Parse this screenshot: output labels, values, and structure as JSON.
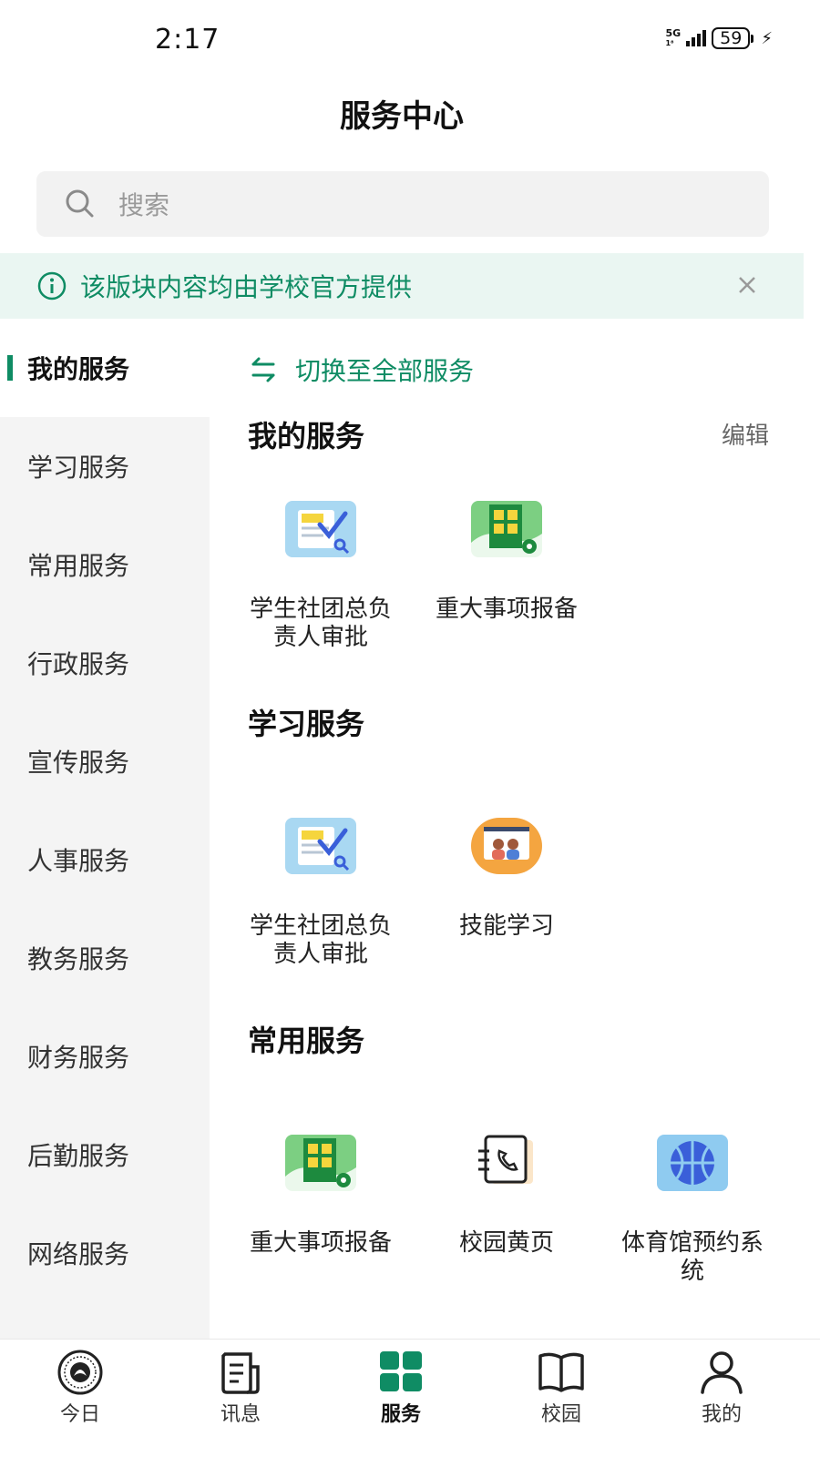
{
  "status_bar": {
    "time": "2:17",
    "network": "5G",
    "network_sub": "1⁸",
    "battery": "59"
  },
  "header": {
    "title": "服务中心"
  },
  "search": {
    "placeholder": "搜索",
    "icon": "search-icon"
  },
  "notice": {
    "text": "该版块内容均由学校官方提供",
    "icon": "info-icon",
    "close_icon": "close-icon"
  },
  "sidebar": {
    "items": [
      {
        "label": "我的服务",
        "active": true
      },
      {
        "label": "学习服务"
      },
      {
        "label": "常用服务"
      },
      {
        "label": "行政服务"
      },
      {
        "label": "宣传服务"
      },
      {
        "label": "人事服务"
      },
      {
        "label": "教务服务"
      },
      {
        "label": "财务服务"
      },
      {
        "label": "后勤服务"
      },
      {
        "label": "网络服务"
      }
    ]
  },
  "content": {
    "switch_label": "切换至全部服务",
    "edit_label": "编辑",
    "sections": [
      {
        "title": "我的服务",
        "items": [
          {
            "label": "学生社团总负责人审批",
            "icon": "approval-document-icon"
          },
          {
            "label": "重大事项报备",
            "icon": "building-report-icon"
          }
        ]
      },
      {
        "title": "学习服务",
        "items": [
          {
            "label": "学生社团总负责人审批",
            "icon": "approval-document-icon"
          },
          {
            "label": "技能学习",
            "icon": "video-class-icon"
          }
        ]
      },
      {
        "title": "常用服务",
        "items": [
          {
            "label": "重大事项报备",
            "icon": "building-report-icon"
          },
          {
            "label": "校园黄页",
            "icon": "phone-book-icon"
          },
          {
            "label": "体育馆预约系统",
            "icon": "basketball-icon"
          }
        ]
      }
    ]
  },
  "tabbar": {
    "tabs": [
      {
        "label": "今日",
        "icon": "school-logo-icon"
      },
      {
        "label": "讯息",
        "icon": "news-icon"
      },
      {
        "label": "服务",
        "icon": "grid-icon",
        "active": true
      },
      {
        "label": "校园",
        "icon": "book-icon"
      },
      {
        "label": "我的",
        "icon": "person-icon"
      }
    ]
  },
  "colors": {
    "accent": "#0f8c64",
    "notice_bg": "#eaf6f2",
    "sidebar_bg": "#f4f4f4"
  }
}
